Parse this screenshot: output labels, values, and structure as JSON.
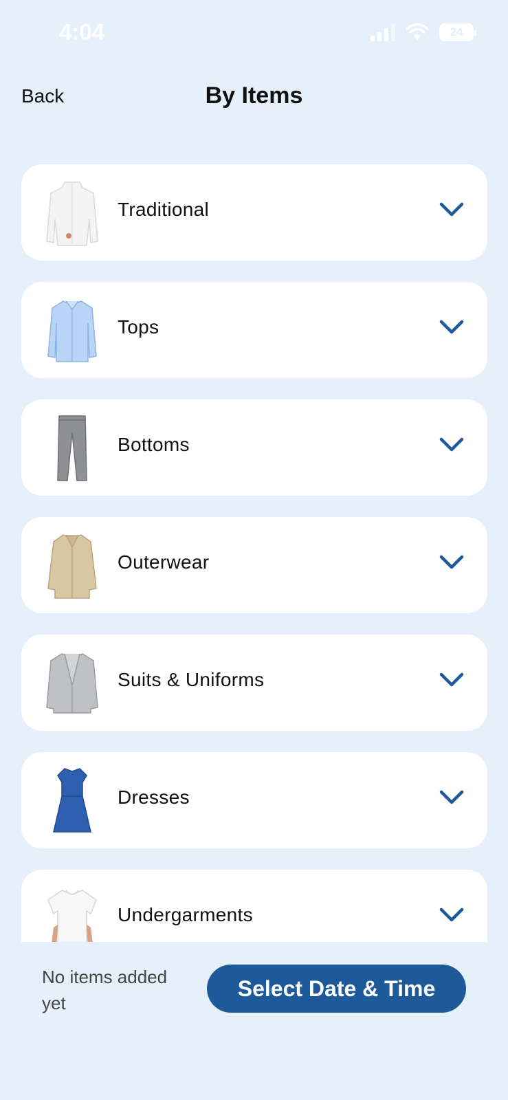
{
  "status_bar": {
    "time": "4:04",
    "battery": "24",
    "icons": [
      "signal-icon",
      "wifi-icon",
      "battery-icon"
    ]
  },
  "header": {
    "back_label": "Back",
    "title": "By Items"
  },
  "categories": [
    {
      "label": "Traditional",
      "icon": "traditional-robe-icon"
    },
    {
      "label": "Tops",
      "icon": "shirt-icon"
    },
    {
      "label": "Bottoms",
      "icon": "trousers-icon"
    },
    {
      "label": "Outerwear",
      "icon": "coat-icon"
    },
    {
      "label": "Suits & Uniforms",
      "icon": "suit-jacket-icon"
    },
    {
      "label": "Dresses",
      "icon": "dress-icon"
    },
    {
      "label": "Undergarments",
      "icon": "tshirt-icon"
    }
  ],
  "footer": {
    "empty_text": "No items added yet",
    "cta_label": "Select Date & Time"
  },
  "colors": {
    "background": "#e6f0fa",
    "card": "#ffffff",
    "accent": "#1e5a9a"
  }
}
